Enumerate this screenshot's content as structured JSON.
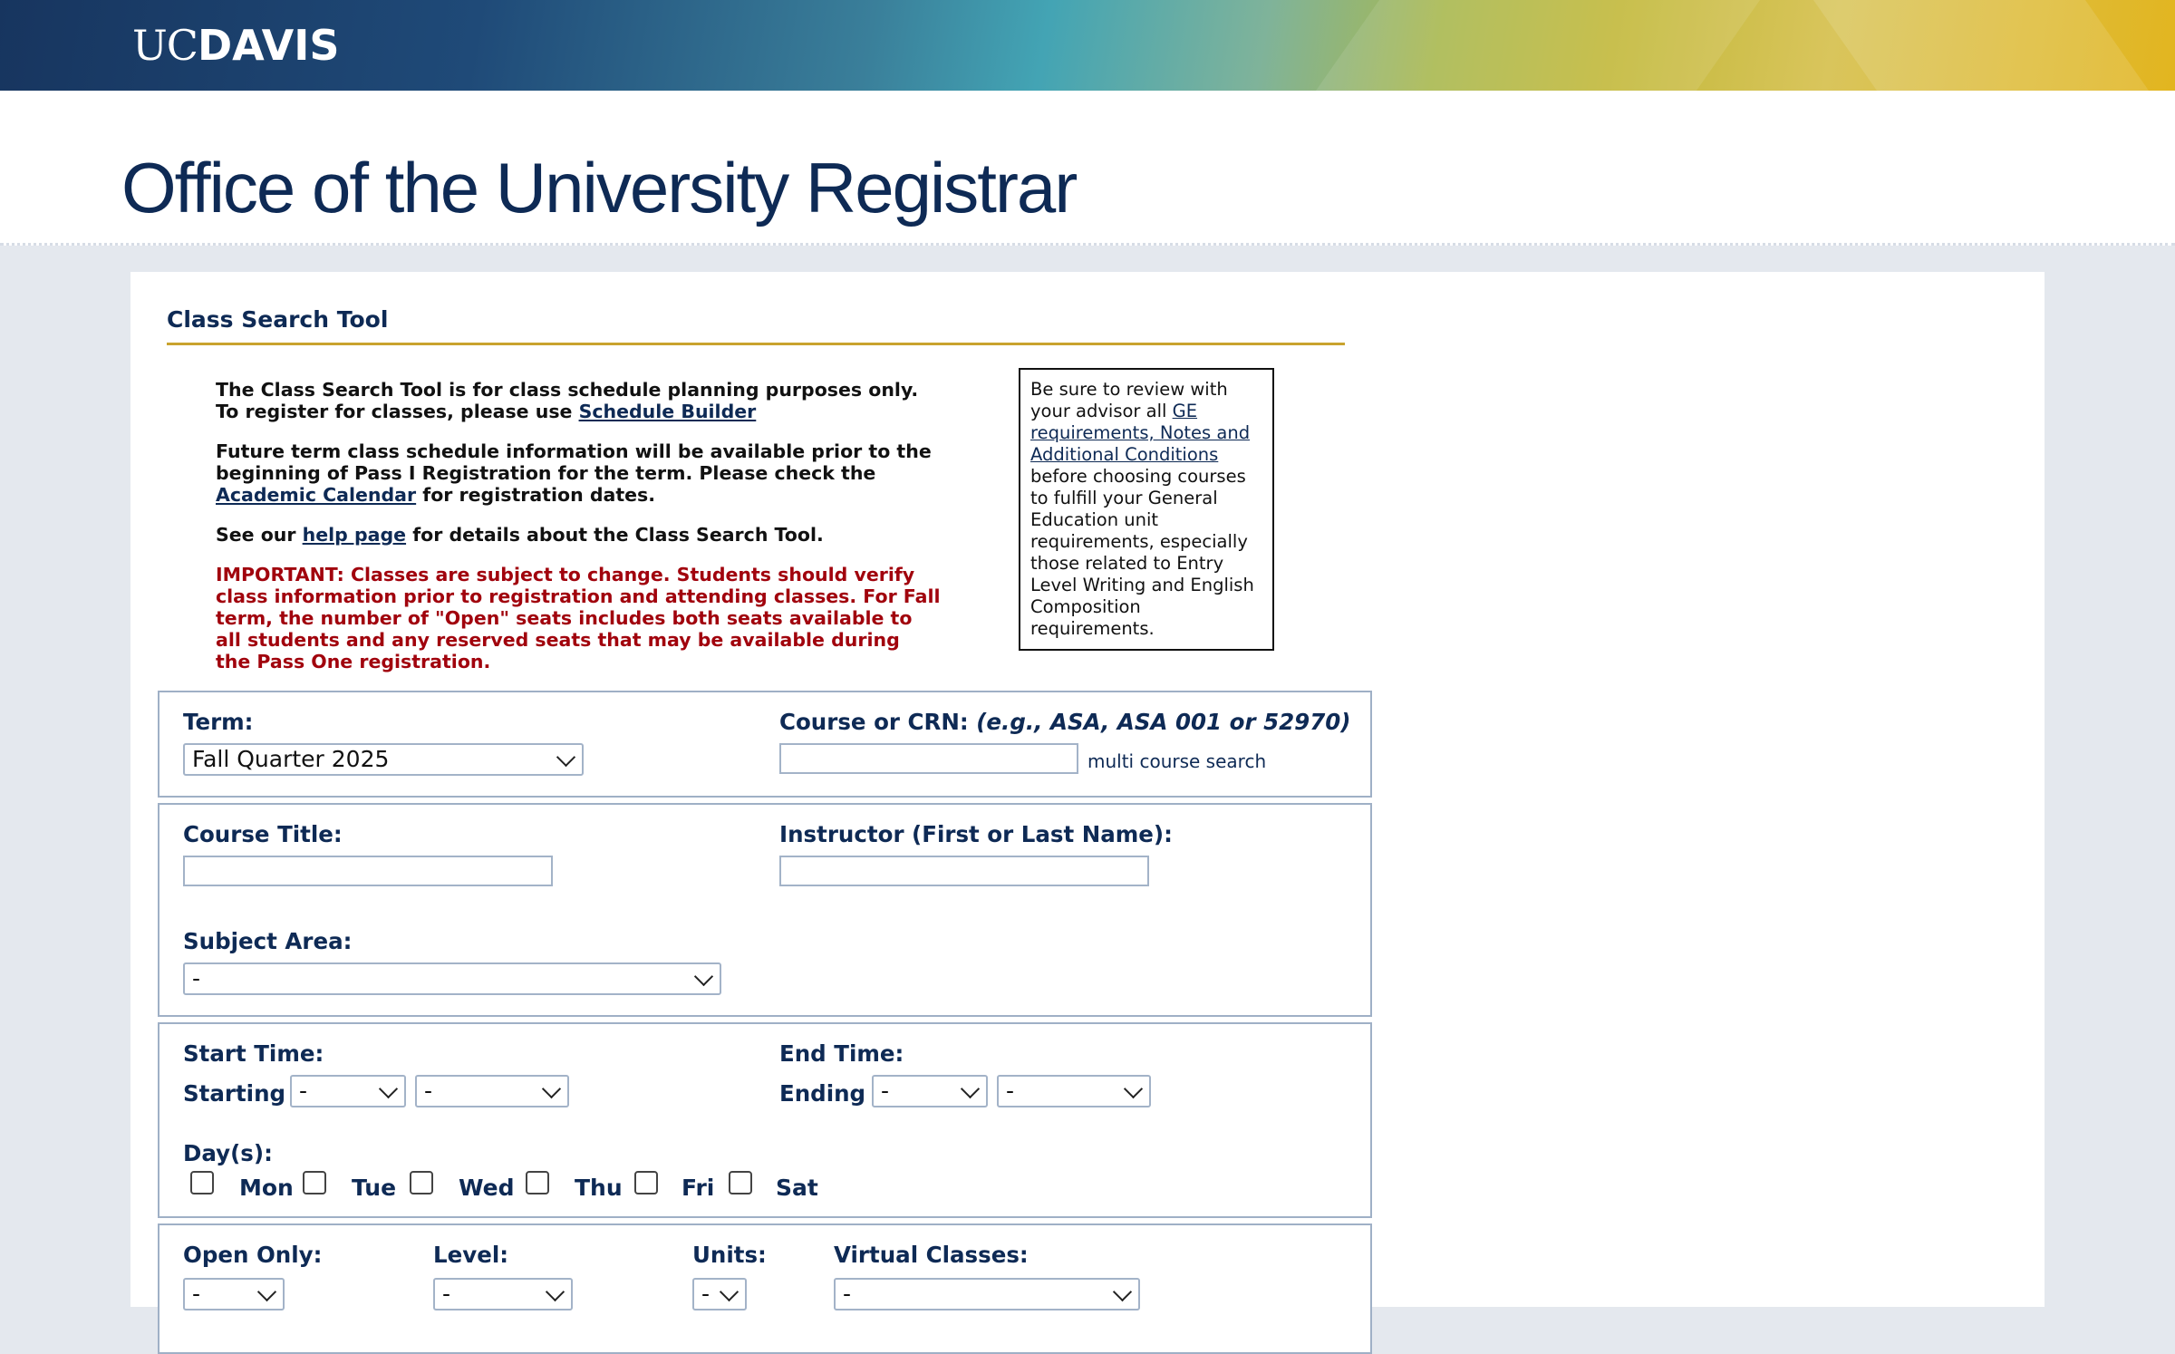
{
  "header": {
    "logo_uc": "UC",
    "logo_davis": "DAVIS",
    "site_title": "Office of the University Registrar"
  },
  "tool": {
    "section_title": "Class Search Tool",
    "intro": {
      "p1_text": "The Class Search Tool is for class schedule planning purposes only. To register for classes, please use ",
      "p1_link": "Schedule Builder",
      "p2_text": "Future term class schedule information will be available prior to the beginning of Pass I Registration for the term. Please check the ",
      "p2_link": "Academic Calendar",
      "p2_after": " for registration dates.",
      "p3_text": "See our ",
      "p3_link": "help page",
      "p3_after": " for details about the Class Search Tool.",
      "important": "IMPORTANT: Classes are subject to change. Students should verify class information prior to registration and attending classes. For Fall term, the number of \"Open\" seats includes both seats available to all students and any reserved seats that may be available during the Pass One registration."
    },
    "notice": {
      "before": "Be sure to review with your advisor all ",
      "link": "GE requirements, Notes and Additional Conditions",
      "after": " before choosing courses to fulfill your General Education unit requirements, especially those related to Entry Level Writing and English Composition requirements."
    }
  },
  "form": {
    "term_label": "Term:",
    "term_value": "Fall Quarter 2025",
    "course_label": "Course or CRN:",
    "course_hint": "(e.g., ASA, ASA 001 or 52970)",
    "course_value": "",
    "multi_course_link": "multi course search",
    "course_title_label": "Course Title:",
    "course_title_value": "",
    "instructor_label": "Instructor (First or Last Name):",
    "instructor_value": "",
    "subject_label": "Subject Area:",
    "subject_value": "-",
    "start_time_label": "Start Time:",
    "starting_label": "Starting",
    "start_hour": "-",
    "start_minute": "-",
    "end_time_label": "End Time:",
    "ending_label": "Ending",
    "end_hour": "-",
    "end_minute": "-",
    "days_label": "Day(s):",
    "days": [
      "Mon",
      "Tue",
      "Wed",
      "Thu",
      "Fri",
      "Sat"
    ],
    "open_only_label": "Open Only:",
    "open_only_value": "-",
    "level_label": "Level:",
    "level_value": "-",
    "units_label": "Units:",
    "units_value": "-",
    "virtual_label": "Virtual Classes:",
    "virtual_value": "-"
  }
}
